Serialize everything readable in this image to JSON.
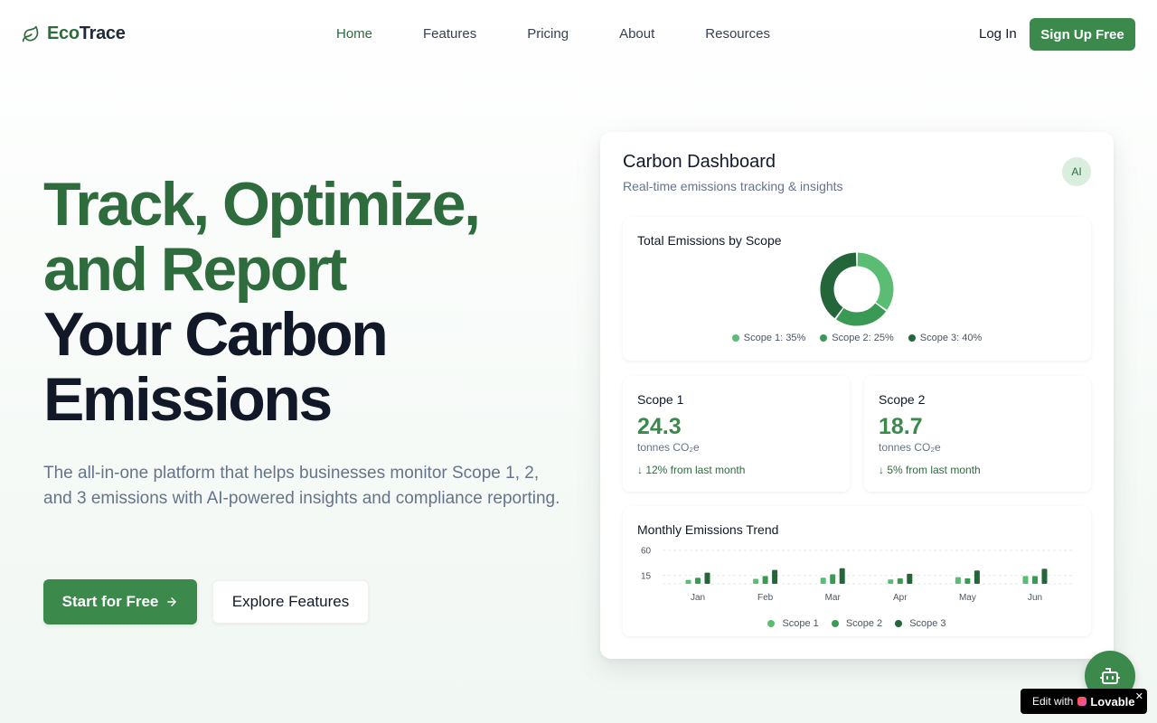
{
  "nav": {
    "brand_eco": "Eco",
    "brand_trace": "Trace",
    "links": [
      "Home",
      "Features",
      "Pricing",
      "About",
      "Resources"
    ],
    "login": "Log In",
    "signup": "Sign Up Free"
  },
  "hero": {
    "line1": "Track, Optimize,",
    "line2": "and Report",
    "line3": "Your Carbon",
    "line4": "Emissions",
    "subtitle": "The all-in-one platform that helps businesses monitor Scope 1, 2, and 3 emissions with AI-powered insights and compliance reporting.",
    "primary_cta": "Start for Free",
    "secondary_cta": "Explore Features"
  },
  "dashboard": {
    "title": "Carbon Dashboard",
    "subtitle": "Real-time emissions tracking & insights",
    "ai_badge": "AI",
    "donut_title": "Total Emissions by Scope",
    "donut_legend": [
      "Scope 1: 35%",
      "Scope 2: 25%",
      "Scope 3: 40%"
    ],
    "scope1": {
      "name": "Scope 1",
      "value": "24.3",
      "unit": "tonnes CO₂e",
      "change": "↓ 12% from last month"
    },
    "scope2": {
      "name": "Scope 2",
      "value": "18.7",
      "unit": "tonnes CO₂e",
      "change": "↓ 5% from last month"
    },
    "trend_title": "Monthly Emissions Trend",
    "trend_legend": [
      "Scope 1",
      "Scope 2",
      "Scope 3"
    ]
  },
  "colors": {
    "brand": "#3b8a4c",
    "scope1": "#5bbd74",
    "scope2": "#3a9a55",
    "scope3": "#24653a"
  },
  "chart_data": [
    {
      "type": "pie",
      "title": "Total Emissions by Scope",
      "categories": [
        "Scope 1",
        "Scope 2",
        "Scope 3"
      ],
      "values": [
        35,
        25,
        40
      ]
    },
    {
      "type": "bar",
      "title": "Monthly Emissions Trend",
      "categories": [
        "Jan",
        "Feb",
        "Mar",
        "Apr",
        "May",
        "Jun"
      ],
      "yticks": [
        15,
        60
      ],
      "ylim": [
        0,
        60
      ],
      "series": [
        {
          "name": "Scope 1",
          "values": [
            7,
            9,
            11,
            8,
            12,
            14
          ]
        },
        {
          "name": "Scope 2",
          "values": [
            11,
            14,
            17,
            10,
            10,
            14
          ]
        },
        {
          "name": "Scope 3",
          "values": [
            20,
            25,
            28,
            18,
            24,
            27
          ]
        }
      ]
    }
  ],
  "floating": {
    "lovable_prefix": "Edit with",
    "lovable_brand": "Lovable",
    "close": "✕"
  }
}
